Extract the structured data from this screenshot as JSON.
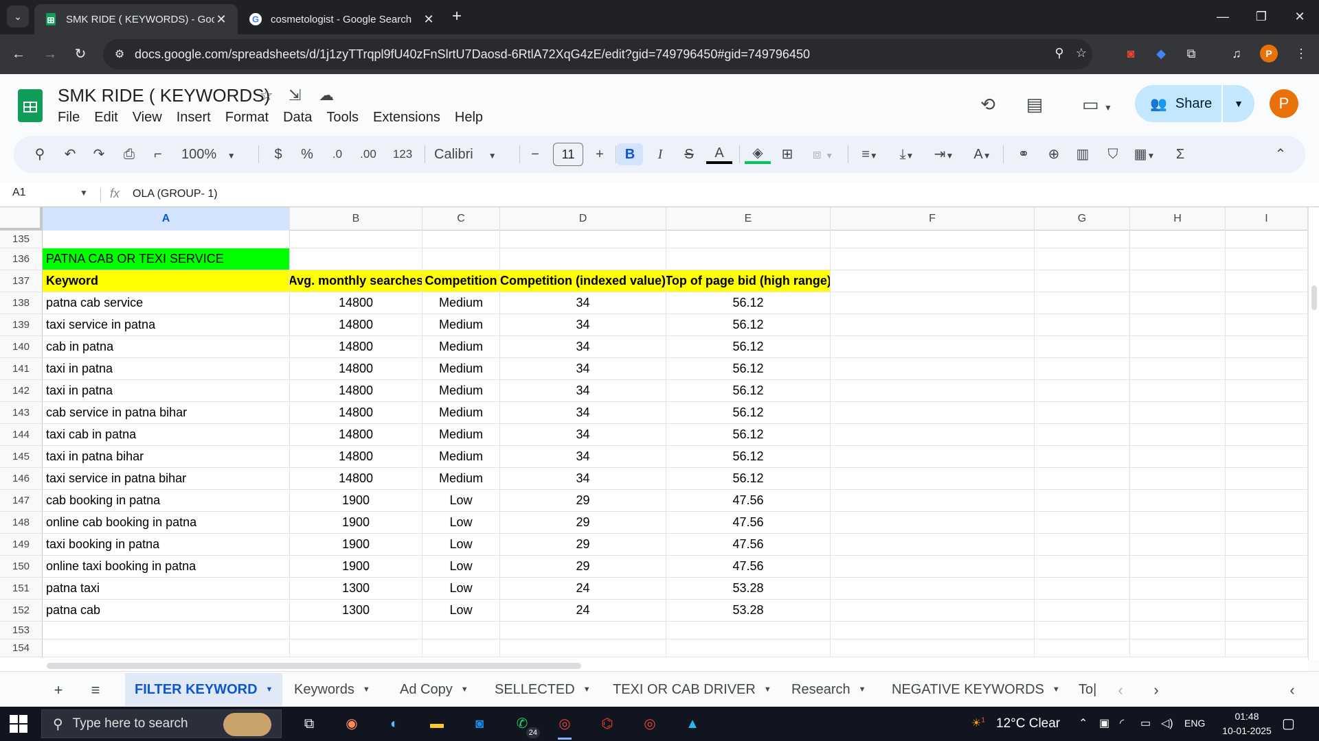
{
  "browser": {
    "tabs": [
      {
        "title": "SMK RIDE ( KEYWORDS) - Goo",
        "active": true
      },
      {
        "title": "cosmetologist - Google Search",
        "active": false
      }
    ],
    "url": "docs.google.com/spreadsheets/d/1j1zyTTrqpl9fU40zFnSlrtU7Daosd-6RtlA72XqG4zE/edit?gid=749796450#gid=749796450",
    "profile_initial": "P"
  },
  "app": {
    "title": "SMK RIDE ( KEYWORDS)",
    "menu": [
      "File",
      "Edit",
      "View",
      "Insert",
      "Format",
      "Data",
      "Tools",
      "Extensions",
      "Help"
    ],
    "share_label": "Share",
    "avatar_initial": "P"
  },
  "toolbar": {
    "zoom": "100%",
    "currency": "$",
    "percent": "%",
    "decrease_decimal": ".0",
    "increase_decimal": ".00",
    "number_format": "123",
    "font": "Calibri",
    "font_size": "11",
    "bold": "B",
    "italic": "I"
  },
  "formula_bar": {
    "cell_ref": "A1",
    "fx": "fx",
    "content": "OLA (GROUP- 1)"
  },
  "grid": {
    "selected_column": "A",
    "columns": [
      "A",
      "B",
      "C",
      "D",
      "E",
      "F",
      "G",
      "H",
      "I"
    ],
    "rows": [
      {
        "num": "135",
        "cells": [
          "",
          "",
          "",
          "",
          ""
        ]
      },
      {
        "num": "136",
        "cells": [
          "PATNA CAB OR TEXI SERVICE",
          "",
          "",
          "",
          ""
        ],
        "style": "section"
      },
      {
        "num": "137",
        "cells": [
          "Keyword",
          "Avg. monthly searches",
          "Competition",
          "Competition (indexed value)",
          "Top of page bid (high range)"
        ],
        "style": "header"
      },
      {
        "num": "138",
        "cells": [
          "patna cab service",
          "14800",
          "Medium",
          "34",
          "56.12"
        ]
      },
      {
        "num": "139",
        "cells": [
          "taxi service in patna",
          "14800",
          "Medium",
          "34",
          "56.12"
        ]
      },
      {
        "num": "140",
        "cells": [
          "cab in patna",
          "14800",
          "Medium",
          "34",
          "56.12"
        ]
      },
      {
        "num": "141",
        "cells": [
          "taxi in patna",
          "14800",
          "Medium",
          "34",
          "56.12"
        ]
      },
      {
        "num": "142",
        "cells": [
          "taxi in patna",
          "14800",
          "Medium",
          "34",
          "56.12"
        ]
      },
      {
        "num": "143",
        "cells": [
          "cab service in patna bihar",
          "14800",
          "Medium",
          "34",
          "56.12"
        ]
      },
      {
        "num": "144",
        "cells": [
          "taxi cab in patna",
          "14800",
          "Medium",
          "34",
          "56.12"
        ]
      },
      {
        "num": "145",
        "cells": [
          "taxi in patna bihar",
          "14800",
          "Medium",
          "34",
          "56.12"
        ]
      },
      {
        "num": "146",
        "cells": [
          "taxi service in patna bihar",
          "14800",
          "Medium",
          "34",
          "56.12"
        ]
      },
      {
        "num": "147",
        "cells": [
          "cab booking in patna",
          "1900",
          "Low",
          "29",
          "47.56"
        ]
      },
      {
        "num": "148",
        "cells": [
          "online cab booking in patna",
          "1900",
          "Low",
          "29",
          "47.56"
        ]
      },
      {
        "num": "149",
        "cells": [
          "taxi booking in patna",
          "1900",
          "Low",
          "29",
          "47.56"
        ]
      },
      {
        "num": "150",
        "cells": [
          "online taxi booking in patna",
          "1900",
          "Low",
          "29",
          "47.56"
        ]
      },
      {
        "num": "151",
        "cells": [
          "patna taxi",
          "1300",
          "Low",
          "24",
          "53.28"
        ]
      },
      {
        "num": "152",
        "cells": [
          "patna cab",
          "1300",
          "Low",
          "24",
          "53.28"
        ]
      },
      {
        "num": "153",
        "cells": [
          "",
          "",
          "",
          "",
          ""
        ]
      },
      {
        "num": "154",
        "cells": [
          "",
          "",
          "",
          "",
          ""
        ]
      }
    ]
  },
  "sheets": {
    "tabs": [
      "FILTER KEYWORD",
      "Keywords",
      "Ad Copy",
      "SELLECTED",
      "TEXI OR CAB DRIVER",
      "Research",
      "NEGATIVE KEYWORDS",
      "To|"
    ],
    "active": "FILTER KEYWORD"
  },
  "taskbar": {
    "search_placeholder": "Type here to search",
    "whatsapp_badge": "24",
    "weather": "12°C  Clear",
    "weather_badge": "1",
    "language": "ENG",
    "time": "01:48",
    "date": "10-01-2025"
  },
  "colors": {
    "section_fill": "#00ff00",
    "header_fill": "#ffff00",
    "accent": "#0b57d0"
  }
}
